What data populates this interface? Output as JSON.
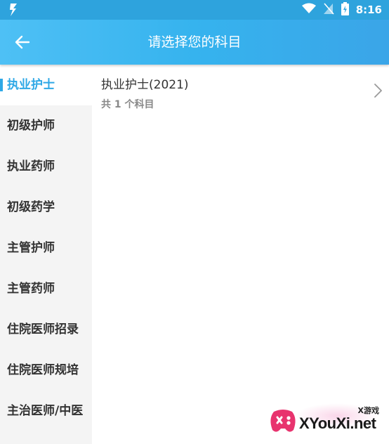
{
  "status_bar": {
    "time": "8:16",
    "icons": [
      "app-notification-icon",
      "wifi-icon",
      "signal-off-icon",
      "battery-icon"
    ]
  },
  "header": {
    "title": "请选择您的科目",
    "back_icon": "arrow-left-icon"
  },
  "sidebar": {
    "items": [
      {
        "label": "执业护士",
        "active": true
      },
      {
        "label": "初级护师",
        "active": false
      },
      {
        "label": "执业药师",
        "active": false
      },
      {
        "label": "初级药学",
        "active": false
      },
      {
        "label": "主管护师",
        "active": false
      },
      {
        "label": "主管药师",
        "active": false
      },
      {
        "label": "住院医师招录",
        "active": false
      },
      {
        "label": "住院医师规培",
        "active": false
      },
      {
        "label": "主治医师/中医",
        "active": false
      }
    ]
  },
  "content": {
    "subjects": [
      {
        "title": "执业护士(2021)",
        "count": "共 1 个科目"
      }
    ]
  },
  "watermark": {
    "small": "X游戏",
    "text": "XYouXi.net"
  },
  "colors": {
    "accent": "#2ea8e6",
    "status_bar": "#2ea3dd",
    "app_bar": "#3bb4ef"
  }
}
